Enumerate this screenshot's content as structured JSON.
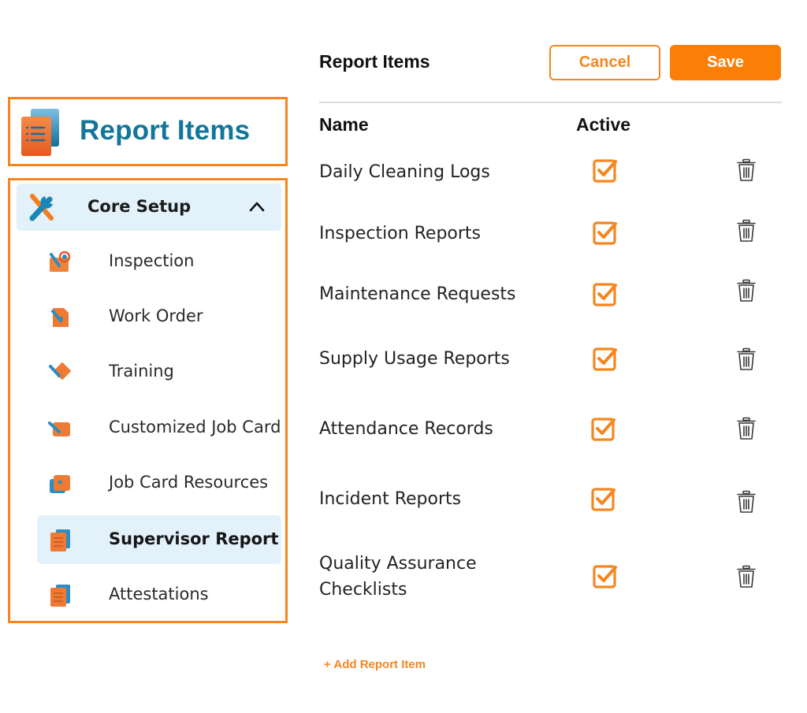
{
  "brand": {
    "title": "Report Items",
    "icon": "report-document-icon"
  },
  "nav": {
    "group": {
      "label": "Core Setup",
      "icon": "tools-icon",
      "expanded": true
    },
    "items": [
      {
        "label": "Inspection",
        "icon": "inspection-icon",
        "active": false
      },
      {
        "label": "Work Order",
        "icon": "work-order-icon",
        "active": false
      },
      {
        "label": "Training",
        "icon": "training-icon",
        "active": false
      },
      {
        "label": "Customized Job Card",
        "icon": "job-card-icon",
        "active": false
      },
      {
        "label": "Job Card Resources",
        "icon": "resources-icon",
        "active": false
      },
      {
        "label": "Supervisor Report",
        "icon": "report-document-icon",
        "active": true
      },
      {
        "label": "Attestations",
        "icon": "report-document-icon",
        "active": false
      }
    ]
  },
  "panel": {
    "title": "Report Items",
    "cancel_label": "Cancel",
    "save_label": "Save",
    "columns": {
      "name": "Name",
      "active": "Active"
    },
    "rows": [
      {
        "name": "Daily Cleaning Logs",
        "active": true
      },
      {
        "name": "Inspection Reports",
        "active": true
      },
      {
        "name": "Maintenance Requests",
        "active": true
      },
      {
        "name": "Supply Usage Reports",
        "active": true
      },
      {
        "name": "Attendance Records",
        "active": true
      },
      {
        "name": "Incident Reports",
        "active": true
      },
      {
        "name": "Quality Assurance Checklists",
        "active": true
      }
    ],
    "add_label": "+ Add Report Item"
  },
  "colors": {
    "accent": "#f5861f",
    "save": "#fb7f06",
    "brand_text": "#12769a",
    "active_bg": "#e3f1fa"
  }
}
